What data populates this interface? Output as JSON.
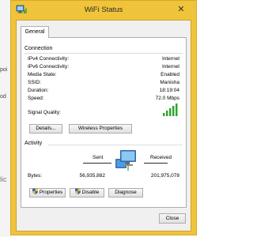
{
  "window": {
    "title": "WiFi Status",
    "close_glyph": "✕",
    "accent_color": "#f0c43a"
  },
  "background": {
    "fragments": [
      "",
      "poi",
      "od",
      "lic"
    ]
  },
  "tabs": [
    {
      "label": "General"
    }
  ],
  "connection": {
    "section_title": "Connection",
    "rows": [
      {
        "label": "IPv4 Connectivity:",
        "value": "Internet"
      },
      {
        "label": "IPv6 Connectivity:",
        "value": "Internet"
      },
      {
        "label": "Media State:",
        "value": "Enabled"
      },
      {
        "label": "SSID:",
        "value": "Manisha"
      },
      {
        "label": "Duration:",
        "value": "18:19:04"
      },
      {
        "label": "Speed:",
        "value": "72.0 Mbps"
      }
    ],
    "signal_quality_label": "Signal Quality:",
    "signal_bars_filled": 5,
    "signal_bars_total": 5,
    "details_button": "Details...",
    "wireless_properties_button": "Wireless Properties"
  },
  "activity": {
    "section_title": "Activity",
    "sent_label": "Sent",
    "received_label": "Received",
    "bytes_label": "Bytes:",
    "bytes_sent": "56,935,882",
    "bytes_received": "201,975,078",
    "properties_button": "Properties",
    "disable_button": "Disable",
    "diagnose_button": "Diagnose"
  },
  "footer": {
    "close_button": "Close"
  },
  "icons": {
    "app": "wifi-network-icon",
    "signal": "signal-bars-icon",
    "network": "network-computer-icon",
    "shield": "uac-shield-icon"
  }
}
